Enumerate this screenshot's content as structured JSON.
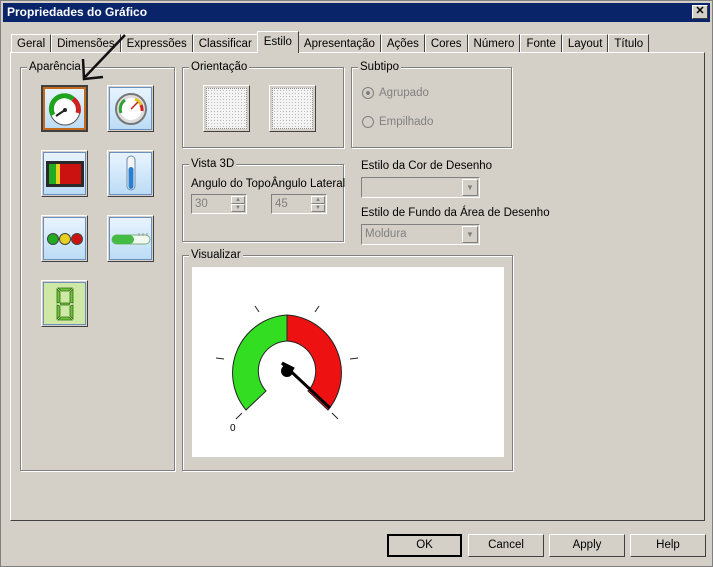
{
  "window": {
    "title": "Propriedades do Gráfico",
    "close_glyph": "✕"
  },
  "tabs": [
    {
      "label": "Geral"
    },
    {
      "label": "Dimensões"
    },
    {
      "label": "Expressões"
    },
    {
      "label": "Classificar"
    },
    {
      "label": "Estilo",
      "active": true
    },
    {
      "label": "Apresentação"
    },
    {
      "label": "Ações"
    },
    {
      "label": "Cores"
    },
    {
      "label": "Número"
    },
    {
      "label": "Fonte"
    },
    {
      "label": "Layout"
    },
    {
      "label": "Título"
    }
  ],
  "appearance": {
    "label": "Aparência",
    "styles": [
      "gauge-green",
      "gauge-grey",
      "bar-traffic",
      "thermometer",
      "traffic-lights",
      "progress-bar",
      "digital-8"
    ],
    "selected": "gauge-green"
  },
  "orientation": {
    "label": "Orientação"
  },
  "subtype": {
    "label": "Subtipo",
    "options": [
      {
        "label": "Agrupado",
        "checked": true
      },
      {
        "label": "Empilhado",
        "checked": false
      }
    ]
  },
  "vista3d": {
    "label": "Vista 3D",
    "top_angle_label": "Angulo do Topo",
    "side_angle_label": "Ângulo Lateral",
    "top_angle_value": "30",
    "side_angle_value": "45"
  },
  "draw_color": {
    "label": "Estilo da Cor de Desenho",
    "value": ""
  },
  "draw_bg": {
    "label": "Estilo de Fundo da Área de Desenho",
    "value": "Moldura"
  },
  "preview": {
    "label": "Visualizar",
    "zero_label": "0"
  },
  "buttons": {
    "ok": "OK",
    "cancel": "Cancel",
    "apply": "Apply",
    "help": "Help"
  },
  "colors": {
    "green": "#33dd22",
    "red": "#ee1111",
    "titlebar": "#0a246a"
  }
}
